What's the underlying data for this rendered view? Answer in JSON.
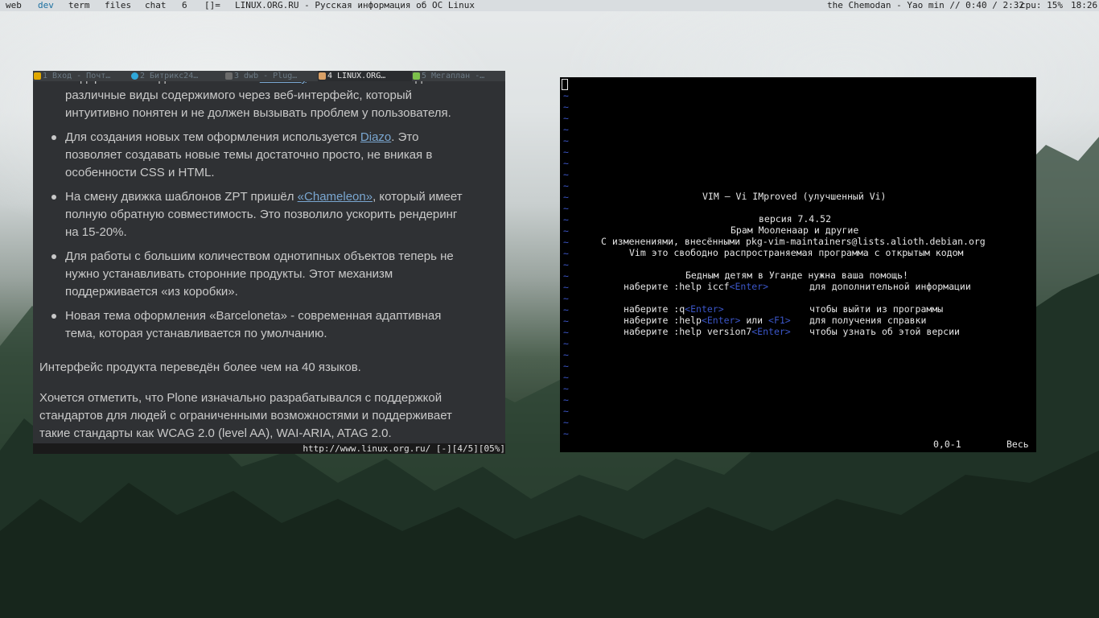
{
  "topbar": {
    "workspaces": [
      "web",
      "dev",
      "term",
      "files",
      "chat",
      "6"
    ],
    "active_workspace": "dev",
    "layout": "[]=",
    "window_title": "LINUX.ORG.RU - Русская информация об ОС Linux",
    "music": "the Chemodan -  Yao min // 0:40 / 2:32",
    "cpu": "cpu: 15%",
    "clock": "18:26"
  },
  "browser": {
    "tabs": [
      {
        "label": "1 Вход - Почт…",
        "icon_color": "#e0a800"
      },
      {
        "label": "2 Битрикс24…",
        "icon_color": "#2fa7d9"
      },
      {
        "label": "3 dwb - Plug…",
        "icon_color": "#6b6b6b"
      },
      {
        "label": "4 LINUX.ORG…",
        "icon_color": "#d9a066"
      },
      {
        "label": "5 Мегаплан -…",
        "icon_color": "#7cc04b"
      }
    ],
    "active_tab": 3,
    "items": [
      {
        "lines": [
          "Содержимое создаётся на основе ",
          "Dexterity",
          ". Это позволяет создавать",
          "различные виды содержимого через веб-интерфейс, который",
          "интуитивно понятен и не должен вызывать проблем у пользователя."
        ]
      },
      {
        "text_a": "Для создания новых тем оформления используется ",
        "link": "Diazo",
        "text_b": ". Это",
        "lines": [
          "позволяет создавать новые темы достаточно просто, не вникая в",
          "особенности CSS и HTML."
        ]
      },
      {
        "text_a": "На смену движка шаблонов ZPT пришёл ",
        "link": "«Chameleon»",
        "text_b": ", который имеет",
        "lines": [
          "полную обратную совместимость. Это позволило ускорить рендеринг",
          "на 15-20%."
        ]
      },
      {
        "lines": [
          "Для работы с большим количеством однотипных объектов теперь не",
          "нужно устанавливать сторонние продукты. Этот механизм",
          "поддерживается «из коробки»."
        ]
      },
      {
        "lines": [
          "Новая тема оформления «Barceloneta» - современная адаптивная",
          "тема, которая устанавливается по умолчанию."
        ]
      }
    ],
    "para1": "Интерфейс продукта переведён более чем на 40 языков.",
    "para2": [
      "Хочется отметить, что Plone изначально разрабатывался с поддержкой",
      "стандартов для людей с ограниченными возможностями и поддерживает",
      "такие стандарты как WCAG 2.0 (level AA), WAI-ARIA, ATAG 2.0."
    ],
    "status": "http://www.linux.org.ru/  [-][4/5][05%]"
  },
  "vim": {
    "title": "VIM — Vi IMproved (улучшенный Vi)",
    "version": "версия 7.4.52",
    "author": "Брам Мооленаар и другие",
    "modified": "С изменениями, внесёнными pkg-vim-maintainers@lists.alioth.debian.org",
    "free": "Vim это свободно распространяемая программа с открытым кодом",
    "uganda": "Бедным детям в Уганде нужна ваша помощь!",
    "help1_cmd": "наберите :help iccf",
    "help1_desc": "для дополнительной информации",
    "quit_cmd": "наберите :q",
    "quit_desc": "чтобы выйти из программы",
    "help2_cmd": "наберите :help",
    "help2_or": " или ",
    "help2_desc": "для получения справки",
    "ver_cmd": "наберите :help version7",
    "ver_desc": "чтобы узнать об этой версии",
    "enter_key": "<Enter>",
    "f1_key": "<F1>",
    "tilde": "~",
    "position": "0,0-1",
    "scroll": "Весь"
  }
}
